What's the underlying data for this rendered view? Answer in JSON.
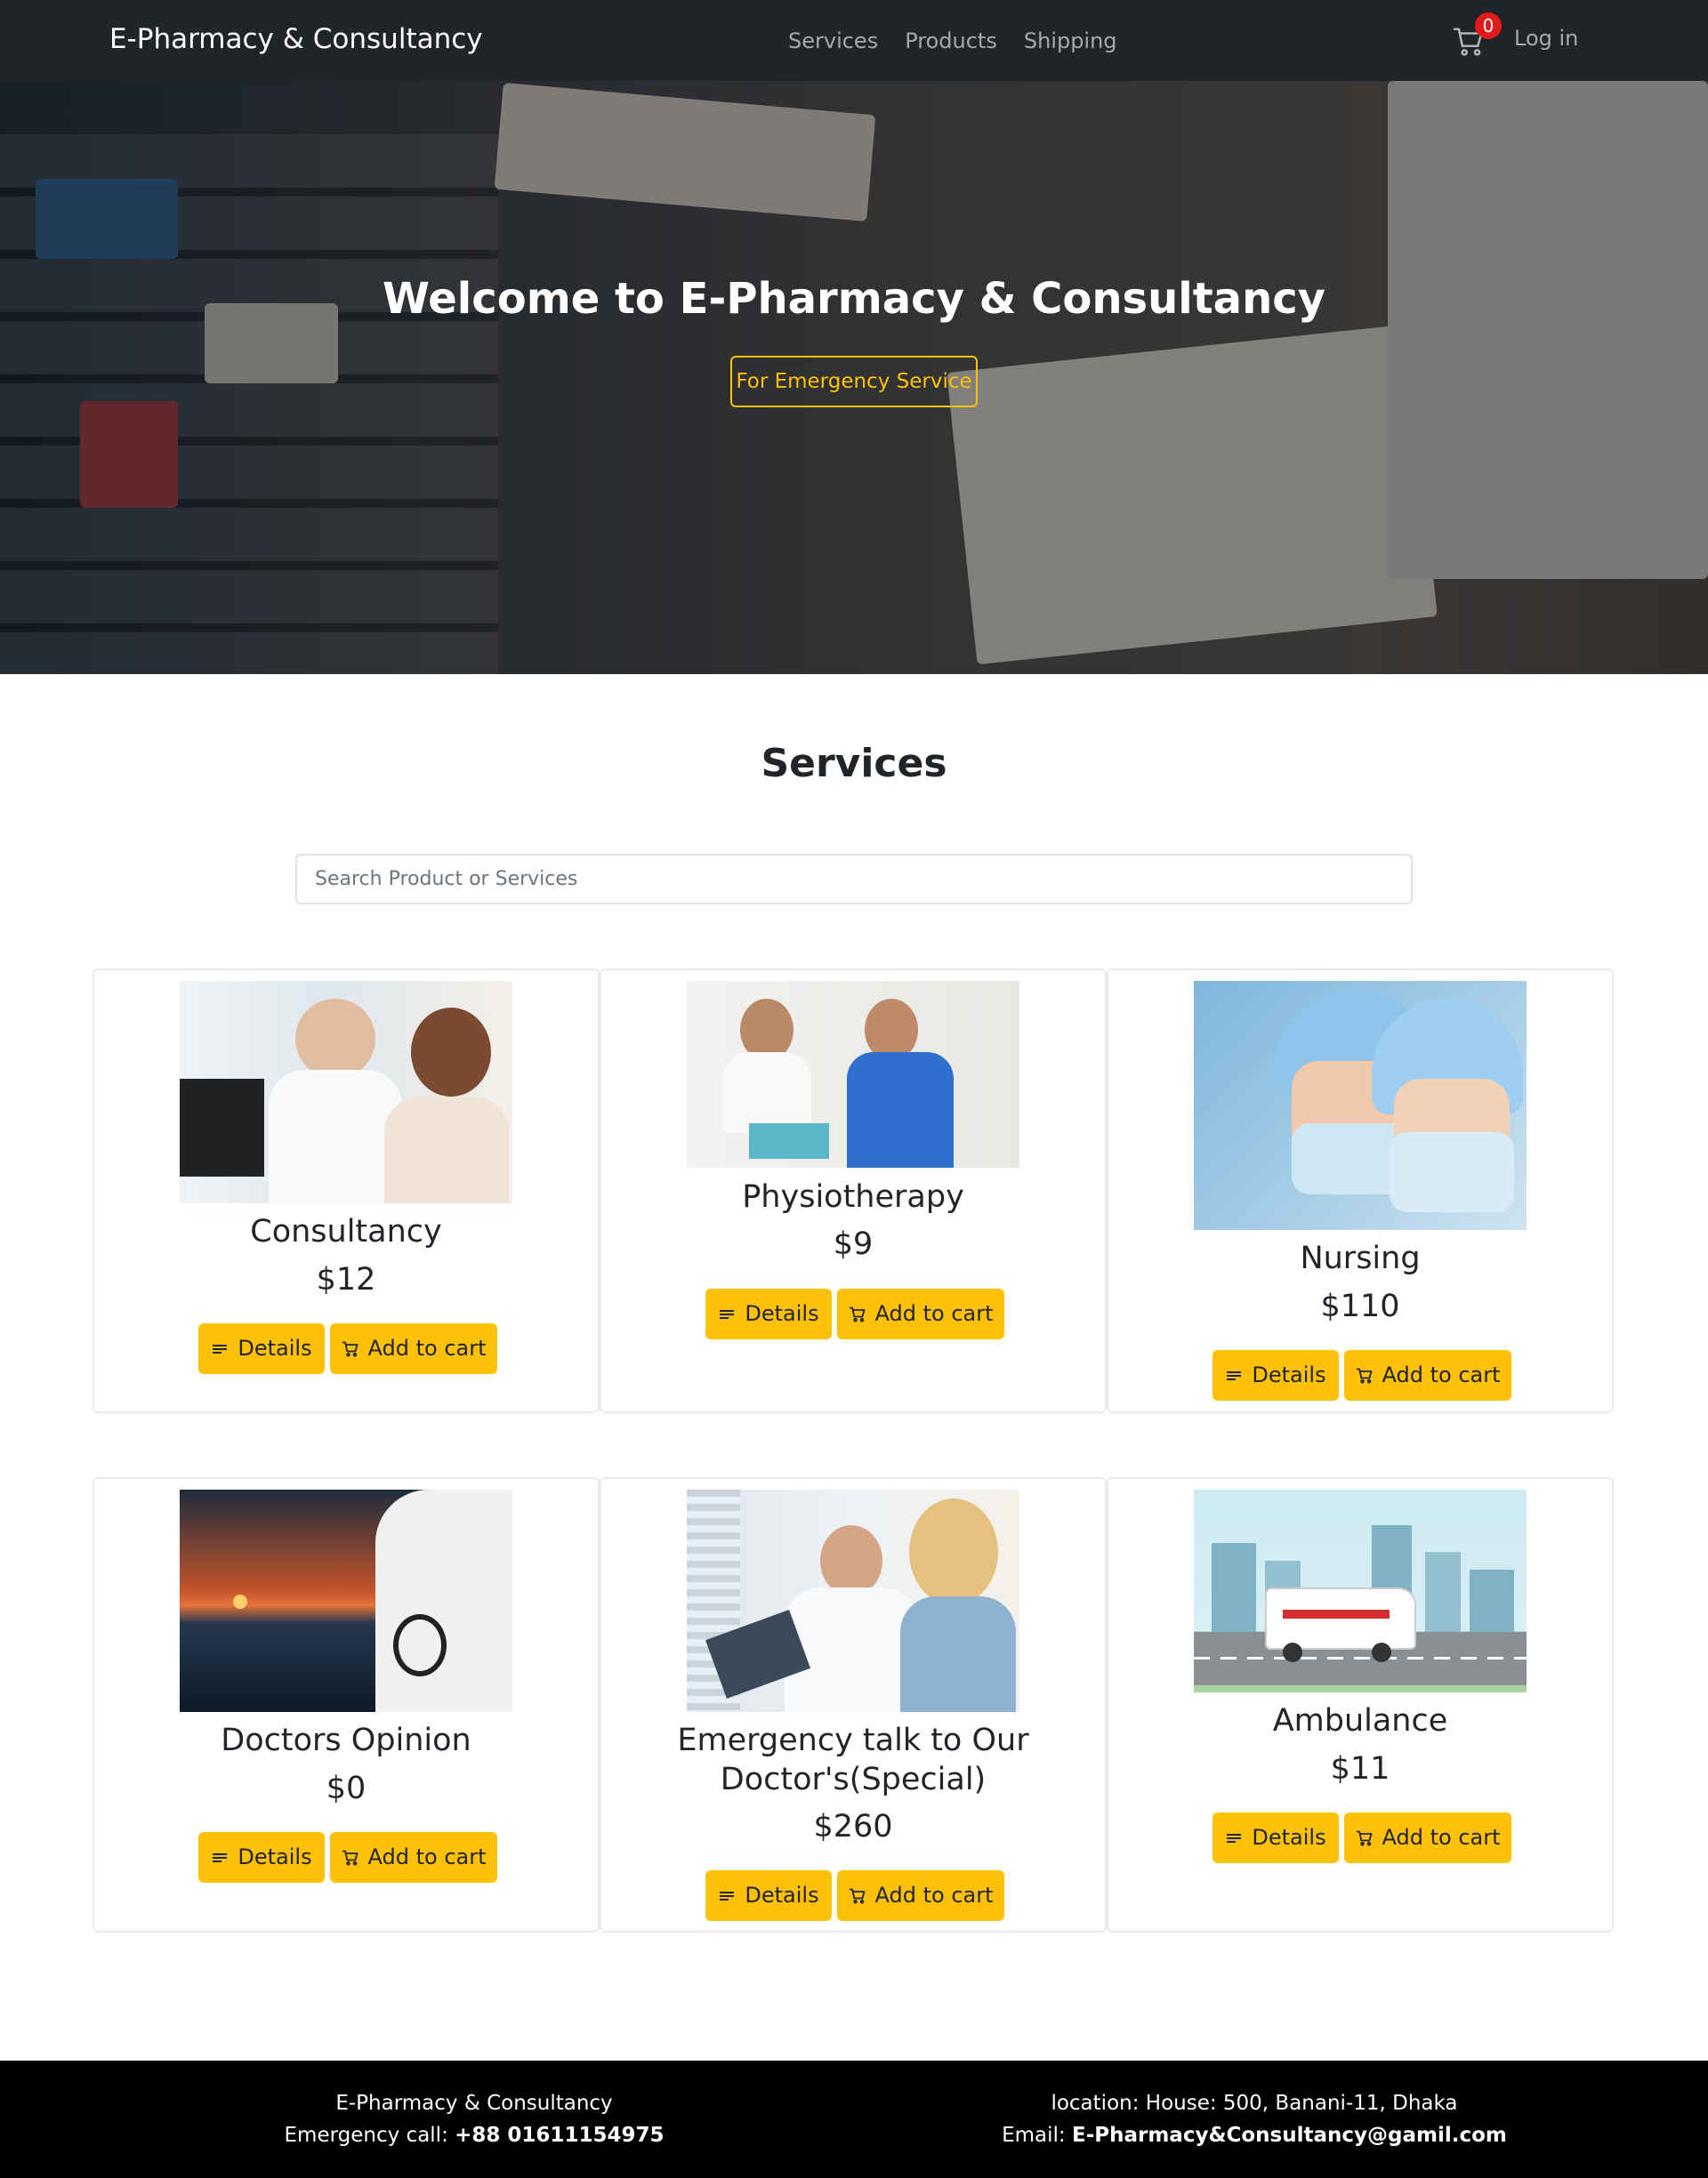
{
  "nav": {
    "brand": "E-Pharmacy & Consultancy",
    "links": [
      "Services",
      "Products",
      "Shipping"
    ],
    "cart_count": "0",
    "login": "Log in"
  },
  "hero": {
    "title": "Welcome to E-Pharmacy & Consultancy",
    "button": "For Emergency Service"
  },
  "services": {
    "title": "Services",
    "search_placeholder": "Search Product or Services",
    "details_label": "Details",
    "cart_label": "Add to cart",
    "items": [
      {
        "name": "Consultancy",
        "price": "$12"
      },
      {
        "name": "Physiotherapy",
        "price": "$9"
      },
      {
        "name": "Nursing",
        "price": "$110"
      },
      {
        "name": "Doctors Opinion",
        "price": "$0"
      },
      {
        "name": "Emergency talk to Our Doctor's(Special)",
        "price": "$260"
      },
      {
        "name": "Ambulance",
        "price": "$11"
      }
    ]
  },
  "footer": {
    "company": "E-Pharmacy & Consultancy",
    "emergency_label": "Emergency call: ",
    "emergency_number": "+88 01611154975",
    "location": "location: House: 500, Banani-11, Dhaka",
    "email_label": "Email: ",
    "email": "E-Pharmacy&Consultancy@gamil.com"
  },
  "colors": {
    "accent": "#ffc107",
    "navbar": "#212529",
    "footer": "#000000",
    "badge": "#e01b1b"
  }
}
